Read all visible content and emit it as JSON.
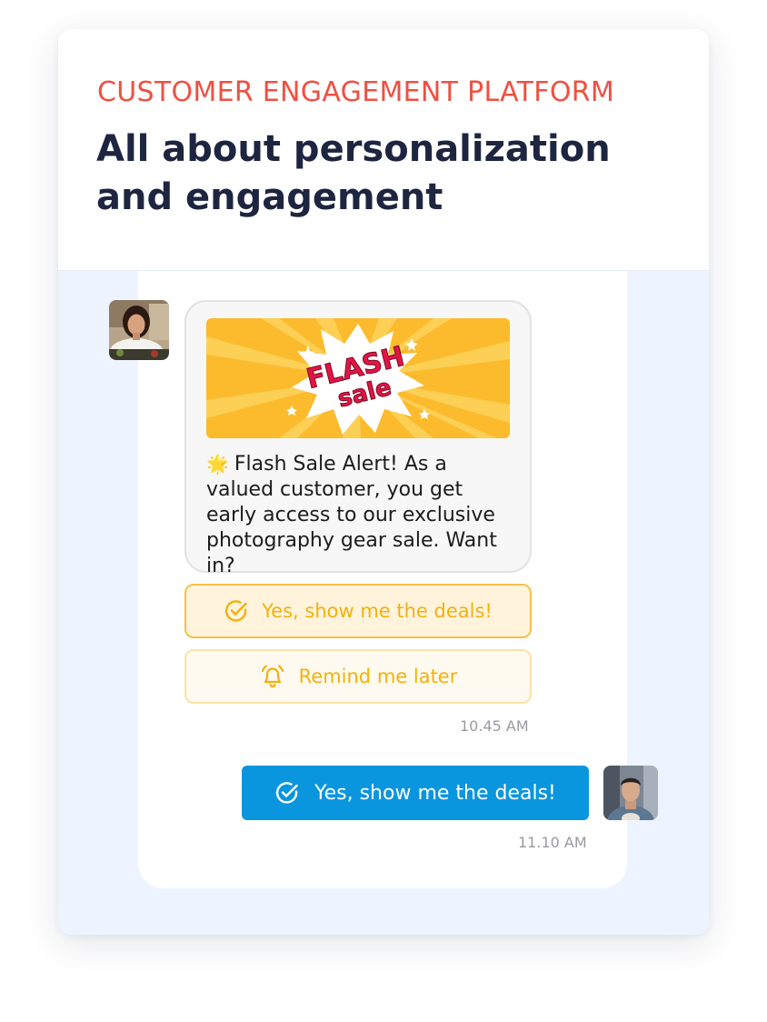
{
  "header": {
    "eyebrow": "CUSTOMER ENGAGEMENT PLATFORM",
    "headline": "All about personalization and engagement"
  },
  "chat": {
    "incoming": {
      "avatar_icon": "agent-avatar",
      "banner": {
        "line1": "FLASH",
        "line2": "sale"
      },
      "emoji": "🌟",
      "message": "Flash Sale Alert! As a valued customer, you get early access to our exclusive photography gear sale. Want in?",
      "time": "10.45 AM"
    },
    "quick_replies": [
      {
        "label": "Yes, show me the deals!",
        "icon": "check-circle-icon"
      },
      {
        "label": "Remind me later",
        "icon": "bell-icon"
      }
    ],
    "outgoing": {
      "avatar_icon": "user-avatar",
      "message": "Yes, show me the deals!",
      "icon": "check-circle-icon",
      "time": "11.10 AM"
    }
  },
  "colors": {
    "accent_red": "#ef5042",
    "headline": "#1e2540",
    "chat_bg": "#eef4ff",
    "quick_reply_text": "#f2b10c",
    "outgoing_bubble": "#0a96de",
    "banner_yellow": "#fbbb2d"
  }
}
